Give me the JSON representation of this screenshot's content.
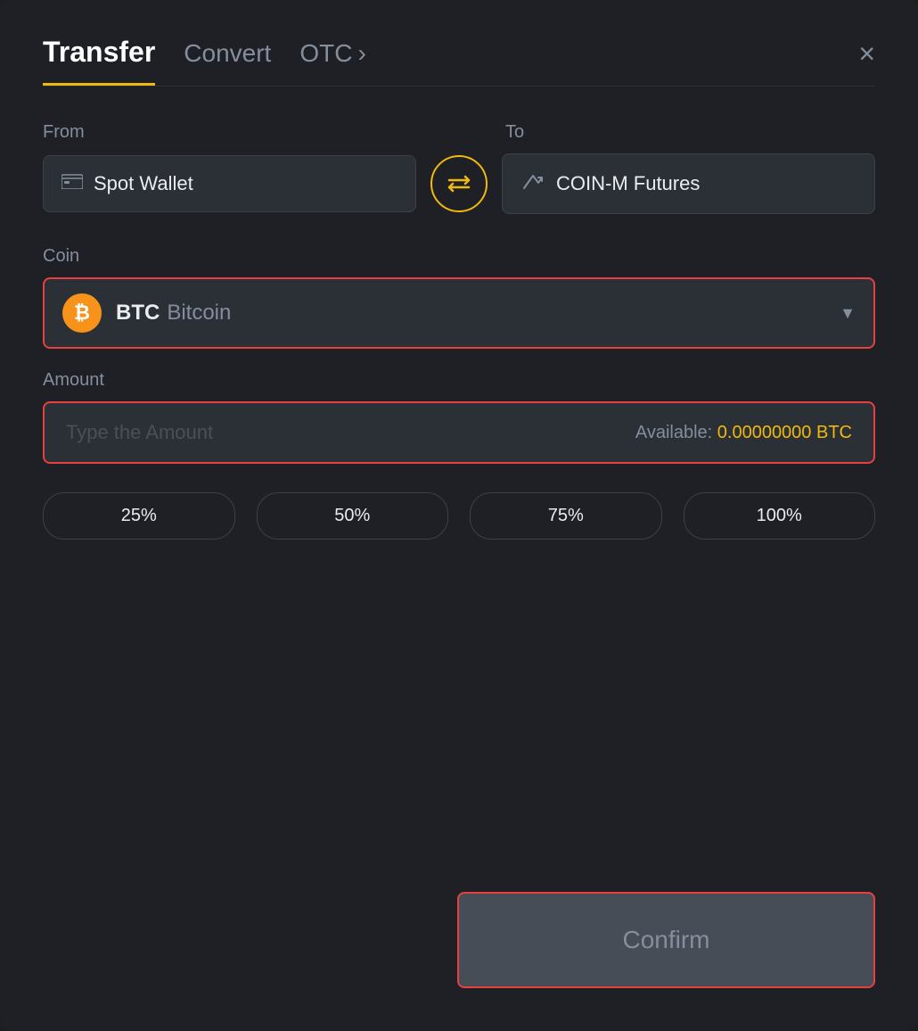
{
  "modal": {
    "tabs": {
      "transfer": "Transfer",
      "convert": "Convert",
      "otc": "OTC"
    },
    "close_label": "×",
    "otc_chevron": "›",
    "from_label": "From",
    "to_label": "To",
    "from_wallet": "Spot Wallet",
    "to_wallet": "COIN-M Futures",
    "coin_label": "Coin",
    "coin_symbol": "BTC",
    "coin_name": "Bitcoin",
    "coin_btc_char": "₿",
    "amount_label": "Amount",
    "amount_placeholder": "Type the Amount",
    "available_label": "Available:",
    "available_value": "0.00000000 BTC",
    "pct_buttons": [
      "25%",
      "50%",
      "75%",
      "100%"
    ],
    "confirm_label": "Confirm",
    "accent_color": "#f0b90b",
    "error_color": "#e84040"
  }
}
